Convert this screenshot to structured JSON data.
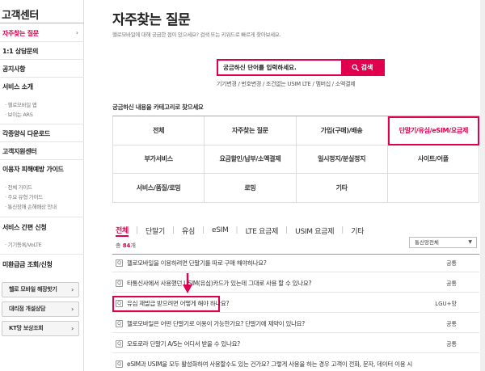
{
  "sidebar": {
    "title": "고객센터",
    "items": [
      {
        "label": "자주찾는 질문",
        "active": true
      },
      {
        "label": "1:1 상담문의"
      },
      {
        "label": "공지사항"
      },
      {
        "label": "서비스 소개"
      },
      {
        "label": "각종양식 다운로드"
      },
      {
        "label": "고객지원센터"
      },
      {
        "label": "이용자 피해예방 가이드"
      },
      {
        "label": "서비스 간편 신청"
      },
      {
        "label": "미환급금 조회/신청"
      }
    ],
    "service_subs": [
      "· 헬로모바일 앱",
      "· 보이는 ARS"
    ],
    "guide_subs": [
      "· 전체 가이드",
      "· 주요 유형 가이드",
      "· 통신장애 손해배상 안내"
    ],
    "apply_subs": [
      "· 기기등록/VoLTE"
    ],
    "buttons": [
      "헬로 모바일 해장핫기",
      "대리점 개설상담",
      "KT망 보상조회"
    ],
    "chevron": "›"
  },
  "header": {
    "title": "자주찾는 질문",
    "description": "헬로모바일에 대해 궁금한 점이 있으세요? 검색 또는 키워드로 빠르게 찾아보세요."
  },
  "search": {
    "placeholder": "궁금하신 단어를 입력하세요.",
    "button_label": "검색",
    "keywords": "기기변경 / 번호변경 / 조건없는 USIM LTE / 멤버십 / 소액결제"
  },
  "categories": {
    "title": "궁금하신 내용을 카테고리로 찾으세요",
    "items": [
      "전체",
      "자주찾는 질문",
      "가입(구매)/배송",
      "단말기/유심/eSIM/요금제",
      "부가서비스",
      "요금할인/납부/소액결제",
      "일시정지/분실정지",
      "사이트/어플",
      "서비스/품질/로밍",
      "로밍",
      "기타",
      ""
    ],
    "active_index": 3
  },
  "tabs": [
    "전체",
    "단말기",
    "유심",
    "eSIM",
    "LTE 요금제",
    "USIM 요금제",
    "기타"
  ],
  "tab_separator": "|",
  "list": {
    "total_prefix": "총",
    "total_count": "84",
    "total_suffix": "개",
    "filter_label": "통신망전체",
    "filter_caret": "▼",
    "q_mark": "Q",
    "rows": [
      {
        "text": "헬로모바일을 이용하려면 단말기를 따로 구매 해야하나요?",
        "category": "공통"
      },
      {
        "text": "타통신사에서 사용했던 USIM(유심)카드가 있는데 그대로 사용 할 수 있나요?",
        "category": "공통"
      },
      {
        "text": "유심 재발급 받으려면 어떻게 해야 하나요?",
        "category": "LGU+망",
        "highlight": true
      },
      {
        "text": "헬로모바일은 어떤 단말기로 이용이 가능한가요? 단말기에 제약이 있나요?",
        "category": "공통"
      },
      {
        "text": "모토로라 단말기 A/S는 어디서 받을 수 있나요?",
        "category": "공통"
      },
      {
        "text": "eSIM과 USIM을 모두 활성화하여 사용할수도 있는 건가요? 그렇게 사용을 하는 경우 고객이 전화, 문자, 데이터 이용 시",
        "category": ""
      }
    ]
  },
  "colors": {
    "accent": "#e0004d"
  }
}
